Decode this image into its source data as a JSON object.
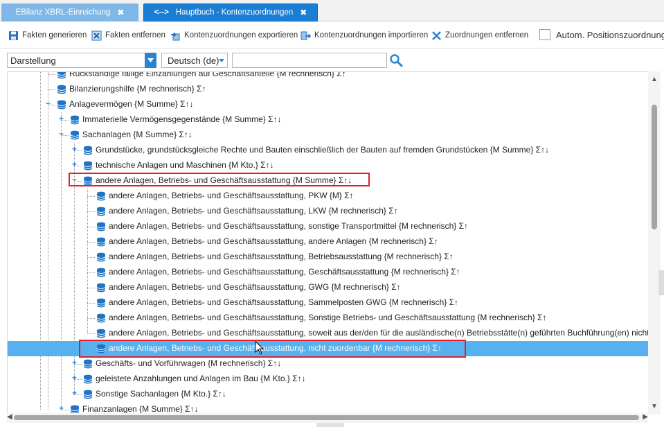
{
  "tabs": [
    {
      "label": "EBilanz XBRL-Einreichung",
      "close": "✖"
    },
    {
      "label": "Hauptbuch - Kontenzuordnungen",
      "close": "✖",
      "icon": "<-->"
    }
  ],
  "toolbar": {
    "buttons": [
      {
        "label": "Fakten generieren",
        "icon": "save-icon"
      },
      {
        "label": "Fakten entfernen",
        "icon": "remove-x-icon"
      },
      {
        "label": "Kontenzuordnungen exportieren",
        "icon": "export-icon"
      },
      {
        "label": "Kontenzuordnungen importieren",
        "icon": "import-icon"
      },
      {
        "label": "Zuordnungen entfernen",
        "icon": "unlink-icon"
      }
    ],
    "autom_label": "Autom. Positionszuordnung"
  },
  "filter": {
    "view": "Darstellung",
    "language": "Deutsch (de)",
    "search_value": ""
  },
  "tree": [
    {
      "label": "Rückständige fällige Einzahlungen auf Geschäftsanteile {M rechnerisch}  Σ↑",
      "level": 2
    },
    {
      "label": "Bilanzierungshilfe {M rechnerisch}  Σ↑",
      "level": 2
    },
    {
      "label": "Anlagevermögen {M Summe}  Σ↑↓",
      "level": 2
    },
    {
      "label": "Immaterielle Vermögensgegenstände {M Summe}  Σ↑↓",
      "level": 3
    },
    {
      "label": "Sachanlagen {M Summe}  Σ↑↓",
      "level": 3
    },
    {
      "label": "Grundstücke, grundstücksgleiche Rechte und Bauten einschließlich der Bauten auf fremden Grundstücken {M Summe}  Σ↑↓",
      "level": 4
    },
    {
      "label": "technische Anlagen und Maschinen {M Kto.}  Σ↑↓",
      "level": 4
    },
    {
      "label": "andere Anlagen, Betriebs- und Geschäftsausstattung {M Summe}  Σ↑↓",
      "level": 4
    },
    {
      "label": "andere Anlagen, Betriebs- und Geschäftsausstattung, PKW {M}  Σ↑",
      "level": 5
    },
    {
      "label": "andere Anlagen, Betriebs- und Geschäftsausstattung, LKW {M rechnerisch}  Σ↑",
      "level": 5
    },
    {
      "label": "andere Anlagen, Betriebs- und Geschäftsausstattung, sonstige Transportmittel {M rechnerisch}  Σ↑",
      "level": 5
    },
    {
      "label": "andere Anlagen, Betriebs- und Geschäftsausstattung, andere Anlagen {M rechnerisch}  Σ↑",
      "level": 5
    },
    {
      "label": "andere Anlagen, Betriebs- und Geschäftsausstattung, Betriebsausstattung {M rechnerisch}  Σ↑",
      "level": 5
    },
    {
      "label": "andere Anlagen, Betriebs- und Geschäftsausstattung, Geschäftsausstattung {M rechnerisch}  Σ↑",
      "level": 5
    },
    {
      "label": "andere Anlagen, Betriebs- und Geschäftsausstattung, GWG {M rechnerisch}  Σ↑",
      "level": 5
    },
    {
      "label": "andere Anlagen, Betriebs- und Geschäftsausstattung, Sammelposten GWG {M rechnerisch}  Σ↑",
      "level": 5
    },
    {
      "label": "andere Anlagen, Betriebs- und Geschäftsausstattung, Sonstige Betriebs- und Geschäftsausstattung {M rechnerisch}  Σ↑",
      "level": 5
    },
    {
      "label": "andere Anlagen, Betriebs- und Geschäftsausstattung, soweit aus der/den für die ausländische(n) Betriebsstätte(n) geführten Buchführung(en) nicht a",
      "level": 5
    },
    {
      "label": "andere Anlagen, Betriebs- und Geschäftsausstattung, nicht zuordenbar {M rechnerisch}  Σ↑",
      "level": 5,
      "selected": true
    },
    {
      "label": "Geschäfts- und Vorführwagen {M rechnerisch}  Σ↑↓",
      "level": 4
    },
    {
      "label": "geleistete Anzahlungen und Anlagen im Bau {M Kto.}  Σ↑↓",
      "level": 4
    },
    {
      "label": "Sonstige Sachanlagen {M Kto.}  Σ↑↓",
      "level": 4
    },
    {
      "label": "Finanzanlagen {M Summe}  Σ↑↓",
      "level": 3
    }
  ],
  "colors": {
    "accent": "#1a7fd4",
    "selection": "#56b1ee",
    "highlight_box": "#e0202a",
    "db_icon": "#1f74c7"
  }
}
